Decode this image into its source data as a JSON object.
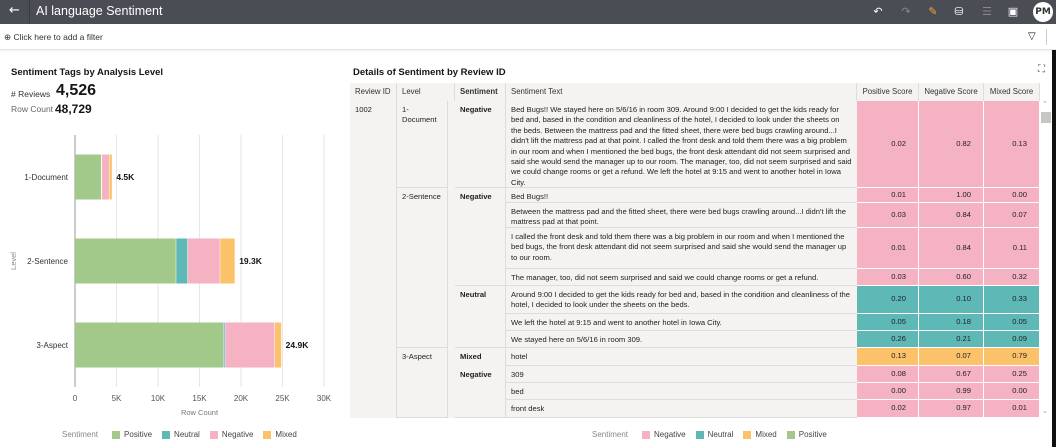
{
  "header": {
    "title": "AI language Sentiment",
    "back_icon": "arrow-left-icon",
    "icons": [
      "undo-icon",
      "redo-icon",
      "edit-icon",
      "data-icon",
      "comment-icon",
      "present-icon"
    ],
    "avatar": "PM"
  },
  "filter": {
    "add_label": "Click here to add a filter"
  },
  "left": {
    "title": "Sentiment Tags by Analysis Level",
    "reviews_label": "# Reviews",
    "reviews_value": "4,526",
    "rowcount_label": "Row Count",
    "rowcount_value": "48,729"
  },
  "colors": {
    "Positive": "#a2c98a",
    "Neutral": "#5eb8b5",
    "Negative": "#f4b2c2",
    "Mixed": "#fcc26a"
  },
  "chart_data": {
    "type": "bar",
    "orientation": "horizontal",
    "stacked": true,
    "categories": [
      "1-Document",
      "2-Sentence",
      "3-Aspect"
    ],
    "series": [
      {
        "name": "Positive",
        "values": [
          3.2,
          12.2,
          17.9
        ]
      },
      {
        "name": "Neutral",
        "values": [
          0.05,
          1.4,
          0.2
        ]
      },
      {
        "name": "Negative",
        "values": [
          0.9,
          3.9,
          6.0
        ]
      },
      {
        "name": "Mixed",
        "values": [
          0.35,
          1.8,
          0.8
        ]
      }
    ],
    "totals_labels": [
      "4.5K",
      "19.3K",
      "24.9K"
    ],
    "xlabel": "Row Count",
    "ylabel": "Level",
    "xlim": [
      0,
      30
    ],
    "x_ticks": [
      "0",
      "5K",
      "10K",
      "15K",
      "20K",
      "25K",
      "30K"
    ],
    "grid": true,
    "legend_title": "Sentiment",
    "legend": [
      "Positive",
      "Neutral",
      "Negative",
      "Mixed"
    ],
    "legend_placement": "bottom"
  },
  "right": {
    "title": "Details of Sentiment by Review ID",
    "expand_icon": "expand-icon",
    "columns": [
      "Review ID",
      "Level",
      "Sentiment",
      "Sentiment Text",
      "Positive Score",
      "Negative Score",
      "Mixed Score"
    ],
    "review_id": "1002",
    "levels": [
      "1-Document",
      "2-Sentence",
      "3-Aspect"
    ],
    "sentiments": [
      "Negative",
      "Negative",
      "Neutral",
      "Mixed",
      "Negative"
    ],
    "rows": [
      {
        "text": "Bed Bugs!! We stayed here on 5/6/16 in room 309. Around 9:00 I decided to get the kids ready for bed and, based in the condition and cleanliness of the hotel, I decided to look under the sheets on the beds. Between the mattress pad and the fitted sheet, there were bed bugs crawling around...I didn't lift the mattress pad at that point. I called the front desk and told them there was a big problem in our room and when I mentioned the bed bugs, the front desk attendant did not seem surprised and said she would send the manager up to our room. The manager, too, did not seem surprised and said we could change rooms or get a refund. We left the hotel at 9:15 and went to another hotel in Iowa City.",
        "pos": "0.02",
        "neg": "0.82",
        "mix": "0.13",
        "sentiment": "Negative"
      },
      {
        "text": "Bed Bugs!!",
        "pos": "0.01",
        "neg": "1.00",
        "mix": "0.00",
        "sentiment": "Negative"
      },
      {
        "text": "Between the mattress pad and the fitted sheet, there were bed bugs crawling around...I didn't lift the mattress pad at that point.",
        "pos": "0.03",
        "neg": "0.84",
        "mix": "0.07",
        "sentiment": "Negative"
      },
      {
        "text": "I called the front desk and told them there was a big problem in our room and when I mentioned the bed bugs, the front desk attendant did not seem surprised and said she would send the manager up to our room.",
        "pos": "0.01",
        "neg": "0.84",
        "mix": "0.11",
        "sentiment": "Negative"
      },
      {
        "text": "The manager, too, did not seem surprised and said we could change rooms or get a refund.",
        "pos": "0.03",
        "neg": "0.60",
        "mix": "0.32",
        "sentiment": "Negative"
      },
      {
        "text": "Around 9:00 I decided to get the kids ready for bed and, based in the condition and cleanliness of the hotel, I decided to look under the sheets on the beds.",
        "pos": "0.20",
        "neg": "0.10",
        "mix": "0.33",
        "sentiment": "Neutral"
      },
      {
        "text": "We left the hotel at 9:15 and went to another hotel in Iowa City.",
        "pos": "0.05",
        "neg": "0.18",
        "mix": "0.05",
        "sentiment": "Neutral"
      },
      {
        "text": "We stayed here on 5/6/16 in room 309.",
        "pos": "0.26",
        "neg": "0.21",
        "mix": "0.09",
        "sentiment": "Neutral"
      },
      {
        "text": "hotel",
        "pos": "0.13",
        "neg": "0.07",
        "mix": "0.79",
        "sentiment": "Mixed"
      },
      {
        "text": "309",
        "pos": "0.08",
        "neg": "0.67",
        "mix": "0.25",
        "sentiment": "Negative"
      },
      {
        "text": "bed",
        "pos": "0.00",
        "neg": "0.99",
        "mix": "0.00",
        "sentiment": "Negative"
      },
      {
        "text": "front desk",
        "pos": "0.02",
        "neg": "0.97",
        "mix": "0.01",
        "sentiment": "Negative"
      }
    ],
    "legend_title": "Sentiment",
    "legend": [
      "Negative",
      "Neutral",
      "Mixed",
      "Positive"
    ]
  }
}
